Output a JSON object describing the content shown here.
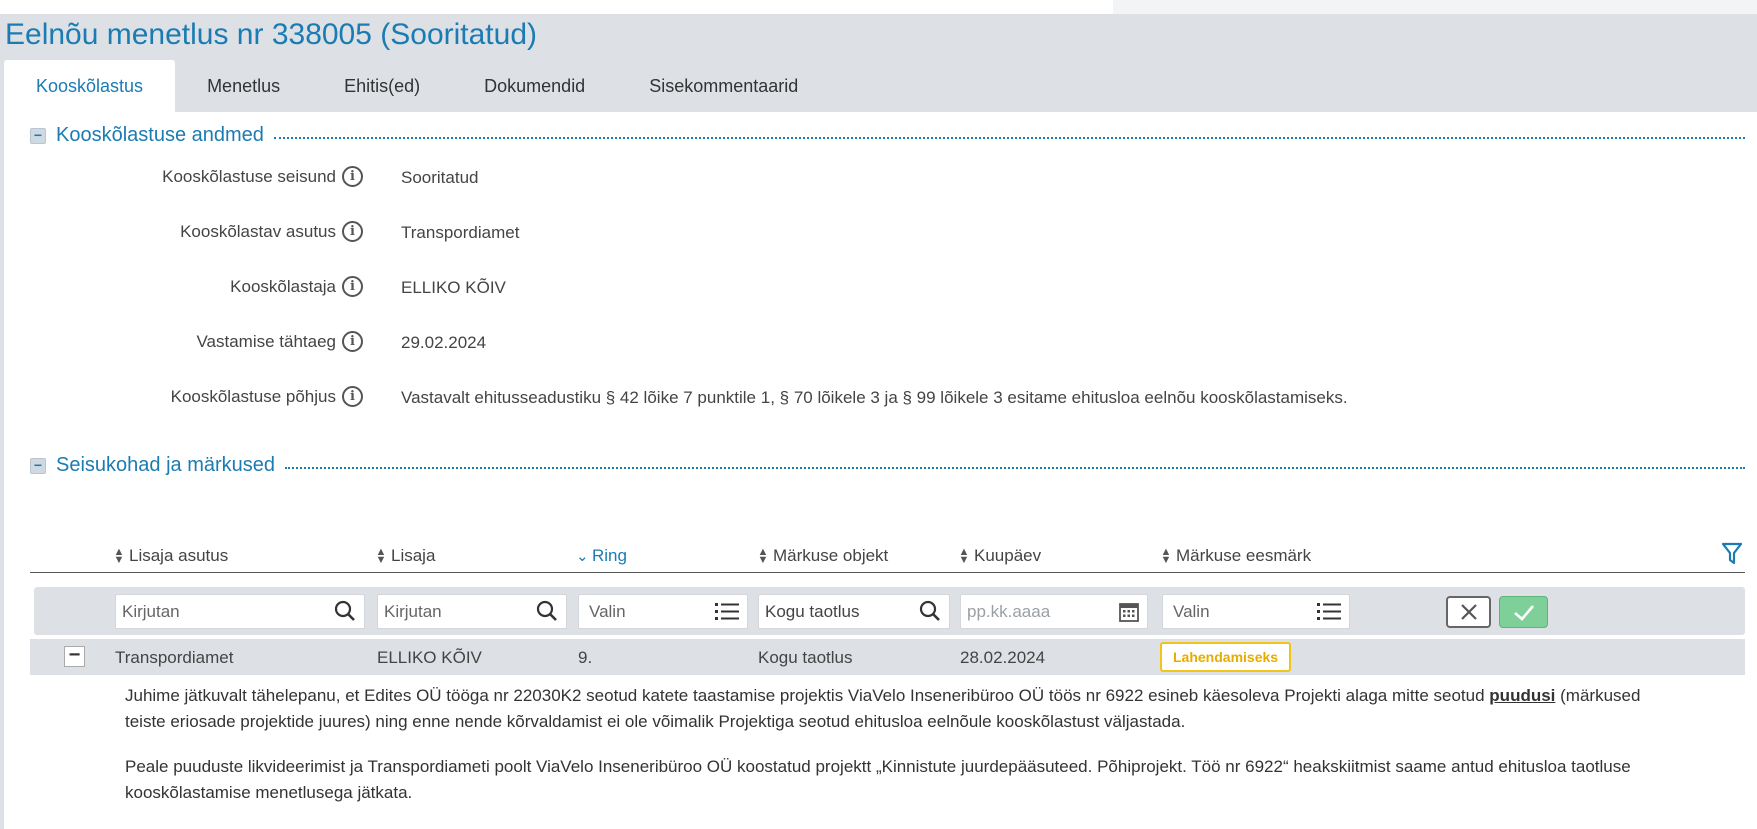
{
  "page": {
    "title": "Eelnõu menetlus nr 338005 (Sooritatud)"
  },
  "tabs": [
    {
      "label": "Kooskõlastus",
      "active": true
    },
    {
      "label": "Menetlus",
      "active": false
    },
    {
      "label": "Ehitis(ed)",
      "active": false
    },
    {
      "label": "Dokumendid",
      "active": false
    },
    {
      "label": "Sisekommentaarid",
      "active": false
    }
  ],
  "section1": {
    "title": "Kooskõlastuse andmed",
    "toggle": "−",
    "fields": [
      {
        "label": "Kooskõlastuse seisund",
        "value": "Sooritatud"
      },
      {
        "label": "Kooskõlastav asutus",
        "value": "Transpordiamet"
      },
      {
        "label": "Kooskõlastaja",
        "value": "ELLIKO KÕIV"
      },
      {
        "label": "Vastamise tähtaeg",
        "value": "29.02.2024"
      },
      {
        "label": "Kooskõlastuse põhjus",
        "value": "Vastavalt ehitusseadustiku § 42 lõike 7 punktile 1, § 70 lõikele 3 ja § 99 lõikele 3 esitame ehitusloa eelnõu kooskõlastamiseks."
      }
    ],
    "info_glyph": "i"
  },
  "section2": {
    "title": "Seisukohad ja märkused",
    "toggle": "−"
  },
  "grid": {
    "columns": [
      {
        "label": "Lisaja asutus",
        "sort": "none"
      },
      {
        "label": "Lisaja",
        "sort": "none"
      },
      {
        "label": "Ring",
        "sort": "desc"
      },
      {
        "label": "Märkuse objekt",
        "sort": "none"
      },
      {
        "label": "Kuupäev",
        "sort": "none"
      },
      {
        "label": "Märkuse eesmärk",
        "sort": "none"
      }
    ],
    "filters": {
      "lisaja_asutus": {
        "placeholder": "Kirjutan",
        "icon": "search-icon"
      },
      "lisaja": {
        "placeholder": "Kirjutan",
        "icon": "search-icon"
      },
      "ring": {
        "placeholder": "Valin",
        "icon": "list-icon"
      },
      "markuse_objekt": {
        "value": "Kogu taotlus",
        "icon": "search-icon"
      },
      "kuupaev": {
        "placeholder": "pp.kk.aaaa",
        "icon": "calendar-icon"
      },
      "markuse_eesmark": {
        "placeholder": "Valin",
        "icon": "list-icon"
      }
    },
    "row": {
      "toggle": "−",
      "lisaja_asutus": "Transpordiamet",
      "lisaja": "ELLIKO KÕIV",
      "ring": "9.",
      "markuse_objekt": "Kogu taotlus",
      "kuupaev": "28.02.2024",
      "markuse_eesmark": "Lahendamiseks",
      "badge_color": "#f0c419"
    },
    "comment": {
      "p1_before": "Juhime jätkuvalt tähelepanu, et Edites OÜ tööga nr 22030K2 seotud katete taastamise projektis ViaVelo Inseneribüroo OÜ töös nr 6922 esineb käesoleva Projekti alaga mitte seotud ",
      "p1_link": "puudusi",
      "p1_after": " (märkused teiste eriosade projektide juures) ning enne nende kõrvaldamist ei ole võimalik Projektiga seotud ehitusloa eelnõule kooskõlastust väljastada.",
      "p2": "Peale puuduste likvideerimist ja Transpordiameti poolt ViaVelo Inseneribüroo OÜ koostatud projektt „Kinnistute juurdepääsuteed. Põhiprojekt. Töö nr 6922“ heakskiitmist saame antud ehitusloa taotluse kooskõlastamise menetlusega jätkata."
    }
  },
  "colors": {
    "accent": "#1b7bb3",
    "background": "#dde1e5",
    "ok_button": "#7fcf98",
    "badge": "#f0c419"
  }
}
